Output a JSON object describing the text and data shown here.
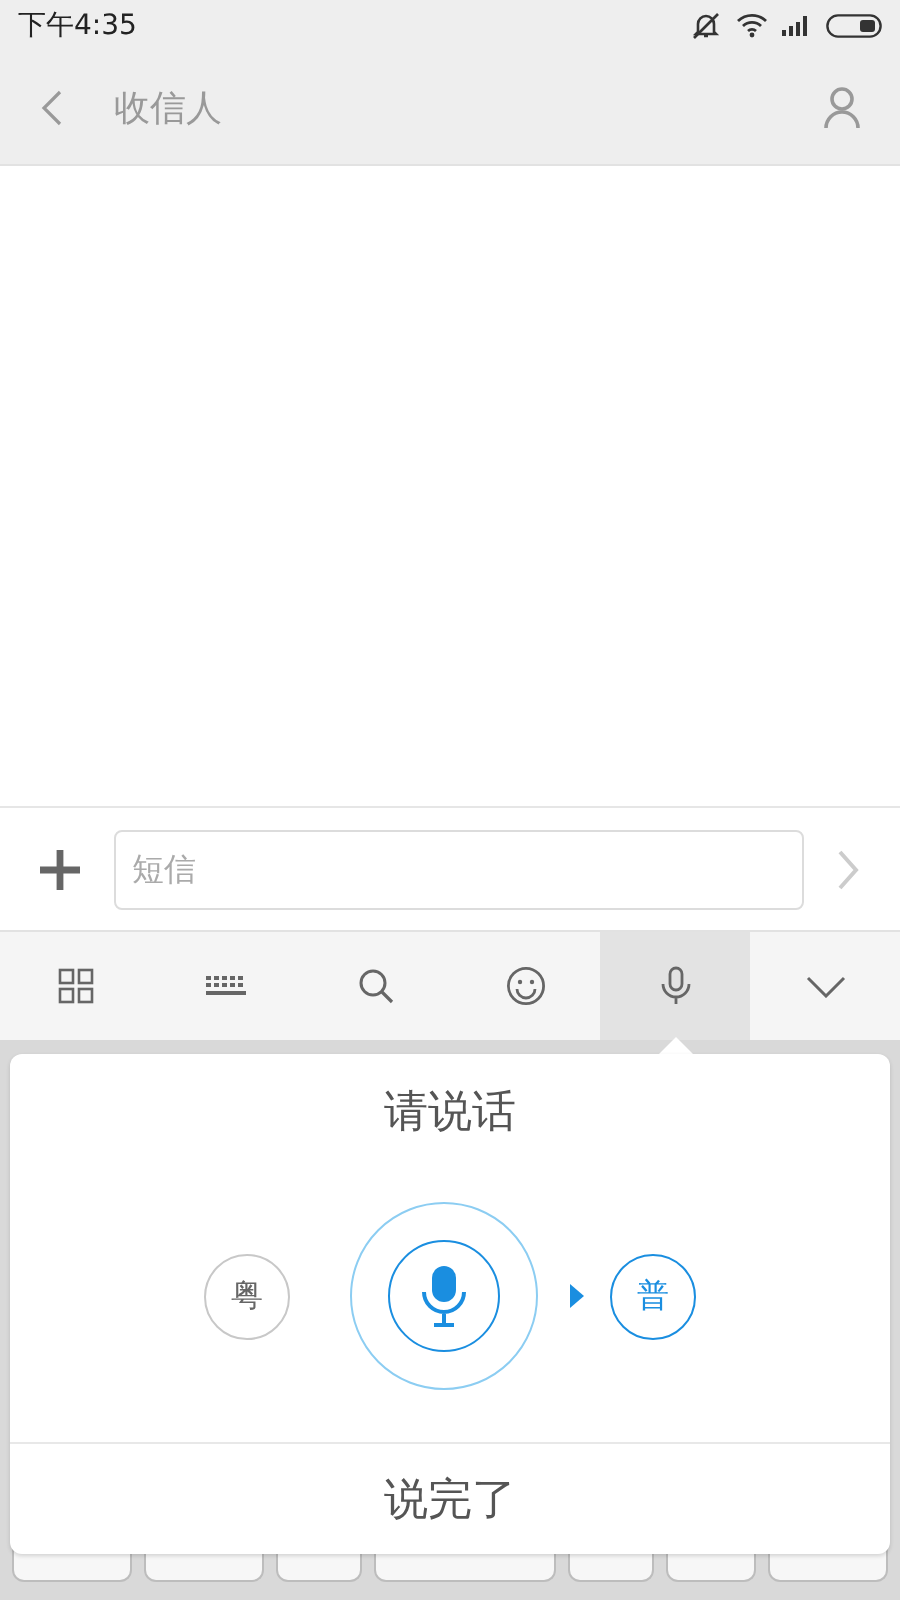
{
  "status_bar": {
    "time": "下午4:35"
  },
  "header": {
    "title": "收信人"
  },
  "composer": {
    "placeholder": "短信"
  },
  "toolbar": [
    {
      "kind": "grid",
      "selected": false
    },
    {
      "kind": "keyboard",
      "selected": false
    },
    {
      "kind": "search",
      "selected": false
    },
    {
      "kind": "emoji",
      "selected": false
    },
    {
      "kind": "voice",
      "selected": true
    },
    {
      "kind": "collapse",
      "selected": false
    }
  ],
  "voice_panel": {
    "prompt": "请说话",
    "languages": [
      {
        "label": "粤",
        "selected": false
      },
      {
        "label": "普",
        "selected": true
      }
    ],
    "done_button": "说完了"
  }
}
